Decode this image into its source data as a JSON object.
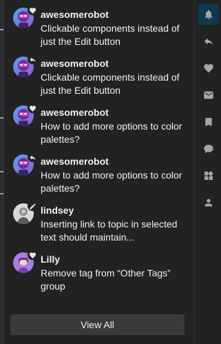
{
  "notifications": [
    {
      "username": "awesomerobot",
      "title": "Clickable components instead of just the Edit button",
      "avatar": "robot",
      "badge_icon": "heart-icon"
    },
    {
      "username": "awesomerobot",
      "title": "Clickable components instead of just the Edit button",
      "avatar": "robot",
      "badge_icon": "reply-icon"
    },
    {
      "username": "awesomerobot",
      "title": "How to add more options to color palettes?",
      "avatar": "robot",
      "badge_icon": "heart-icon"
    },
    {
      "username": "awesomerobot",
      "title": "How to add more options to color palettes?",
      "avatar": "robot",
      "badge_icon": "reply-icon"
    },
    {
      "username": "lindsey",
      "title": "Inserting link to topic in selected text should maintain...",
      "avatar": "lindsey",
      "badge_icon": "pencil-icon"
    },
    {
      "username": "Lilly",
      "title": "Remove tag from “Other Tags” group",
      "avatar": "lilly",
      "badge_icon": "heart-icon"
    }
  ],
  "view_all_label": "View All",
  "rail_icons": [
    "bell-icon",
    "reply-icon",
    "heart-icon",
    "envelope-icon",
    "bookmark-icon",
    "comment-icon",
    "widgets-icon",
    "user-icon"
  ],
  "colors": {
    "panel_bg": "#222222",
    "text": "#f2f2f2",
    "icon_gray": "#a6a6a6",
    "active_tab_bg": "#0e3a4d",
    "button_bg": "#3a3a3a"
  }
}
